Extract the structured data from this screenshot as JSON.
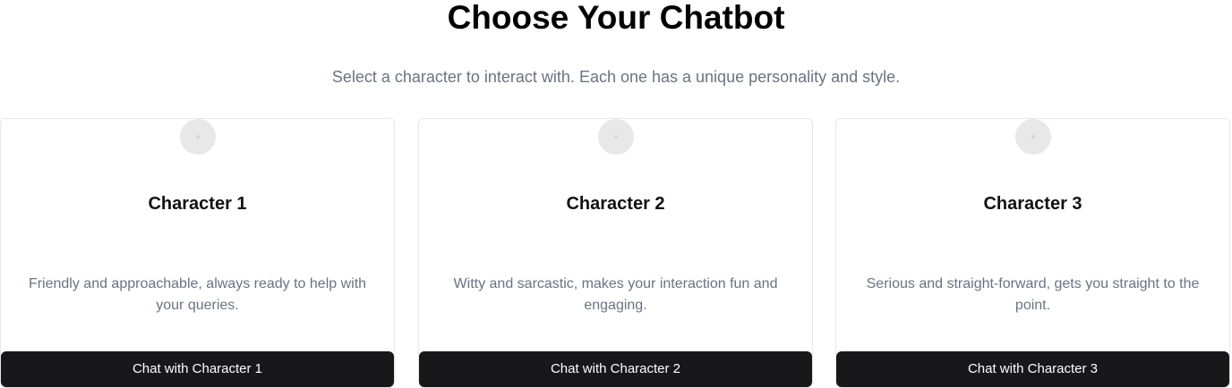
{
  "page": {
    "title": "Choose Your Chatbot",
    "subtitle": "Select a character to interact with. Each one has a unique personality and style."
  },
  "characters": [
    {
      "name": "Character 1",
      "description": "Friendly and approachable, always ready to help with your queries.",
      "button_label": "Chat with Character 1",
      "avatar_icon": "avatar-placeholder-icon"
    },
    {
      "name": "Character 2",
      "description": "Witty and sarcastic, makes your interaction fun and engaging.",
      "button_label": "Chat with Character 2",
      "avatar_icon": "avatar-placeholder-icon"
    },
    {
      "name": "Character 3",
      "description": "Serious and straight-forward, gets you straight to the point.",
      "button_label": "Chat with Character 3",
      "avatar_icon": "avatar-placeholder-icon"
    }
  ],
  "colors": {
    "button_bg": "#18181b",
    "button_text": "#ffffff",
    "muted_text": "#6b7280",
    "card_border": "#e5e7eb",
    "avatar_bg": "#e8e8e8"
  }
}
